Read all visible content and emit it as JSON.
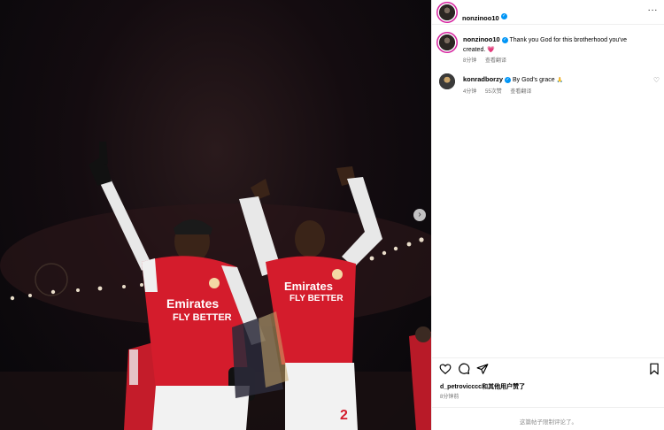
{
  "post": {
    "author": "nonzinoo10",
    "photo_next_icon": "chevron-right-icon"
  },
  "caption": {
    "author": "nonzinoo10",
    "text": "Thank you God for this brotherhood you've created.",
    "emoji": "💗",
    "time": "8分钟",
    "translate": "查看翻译"
  },
  "comments": [
    {
      "author": "konradborzy",
      "text": "By God's grace",
      "emoji": "🙏",
      "time": "4分钟",
      "likes": "55次赞",
      "translate": "查看翻译"
    }
  ],
  "engagement": {
    "liked_by": "d_petrovicccc和其他用户赞了",
    "time": "8分钟前"
  },
  "footer": {
    "comments_disabled": "这篇帖子限制评论了。"
  },
  "colors": {
    "verified": "#0095f6",
    "kit_red": "#d41c2c",
    "story_ring": "#d6249f"
  }
}
